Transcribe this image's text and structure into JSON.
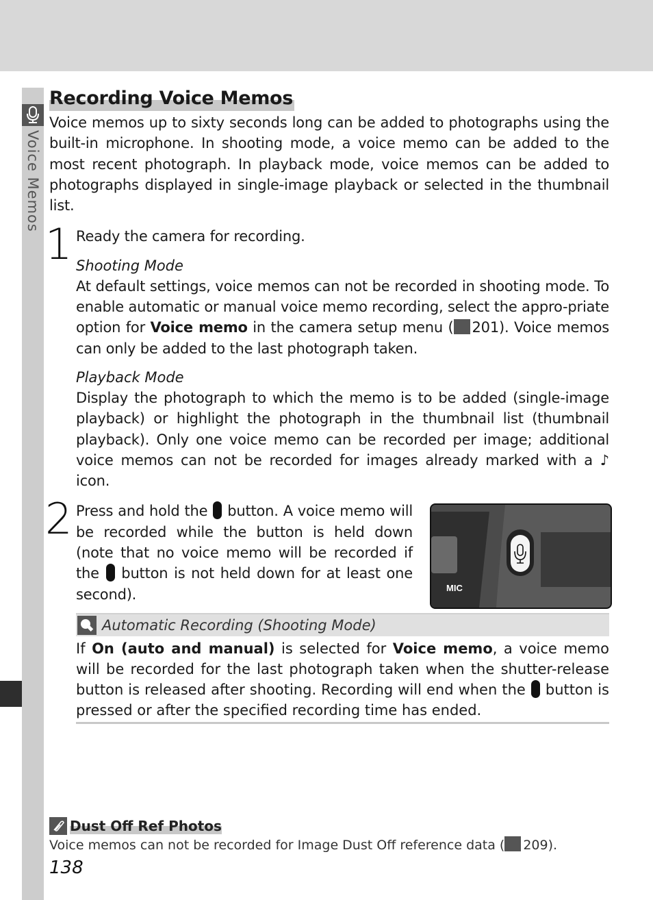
{
  "sidebar": {
    "section_label": "Voice Memos"
  },
  "title": "Recording Voice Memos",
  "intro": "Voice memos up to sixty seconds long can be added to photographs using the built-in microphone.  In shooting mode, a voice memo can be added to the most recent photograph.  In playback mode, voice memos can be added to photographs displayed in single-image playback or selected in the thumbnail list.",
  "steps": [
    {
      "number": "1",
      "text": "Ready the camera for recording.",
      "shooting_heading": "Shooting Mode",
      "shooting_text_a": "At default settings, voice memos can not be recorded in shooting mode.  To enable automatic or manual voice memo recording, select the appro-priate option for ",
      "shooting_bold": "Voice memo",
      "shooting_text_b": " in the camera setup menu (",
      "shooting_ref": "201",
      "shooting_text_c": ").  Voice memos can only be added to the last photograph taken.",
      "playback_heading": "Playback Mode",
      "playback_text": "Display the photograph to which the memo is to be added (single-image playback) or highlight the photograph in the thumbnail list (thumbnail playback).  Only one voice memo can be recorded per image; additional voice memos can not be recorded for images already marked with a ",
      "playback_text_end": " icon."
    },
    {
      "number": "2",
      "text_a": "Press and hold the ",
      "text_b": " button.  A voice memo will be recorded while the button is held down (note that no voice memo will be recorded if the ",
      "text_c": " button is not held down for at least one second).",
      "figure_label": "MIC"
    }
  ],
  "note": {
    "title": "Automatic Recording (Shooting Mode)",
    "text_a": "If ",
    "bold_a": "On (auto and manual)",
    "text_b": " is selected for ",
    "bold_b": "Voice memo",
    "text_c": ", a voice memo will be recorded for the last photograph taken when the shutter-release button is released after shooting.  Recording will end when the ",
    "text_d": " button is pressed or after the specified recording time has ended."
  },
  "tip": {
    "title": "Dust Off Ref Photos",
    "text_a": "Voice memos can not be recorded for Image Dust Off reference data (",
    "ref": "209",
    "text_b": ")."
  },
  "page_number": "138",
  "icons": {
    "note_symbol": "♪"
  }
}
